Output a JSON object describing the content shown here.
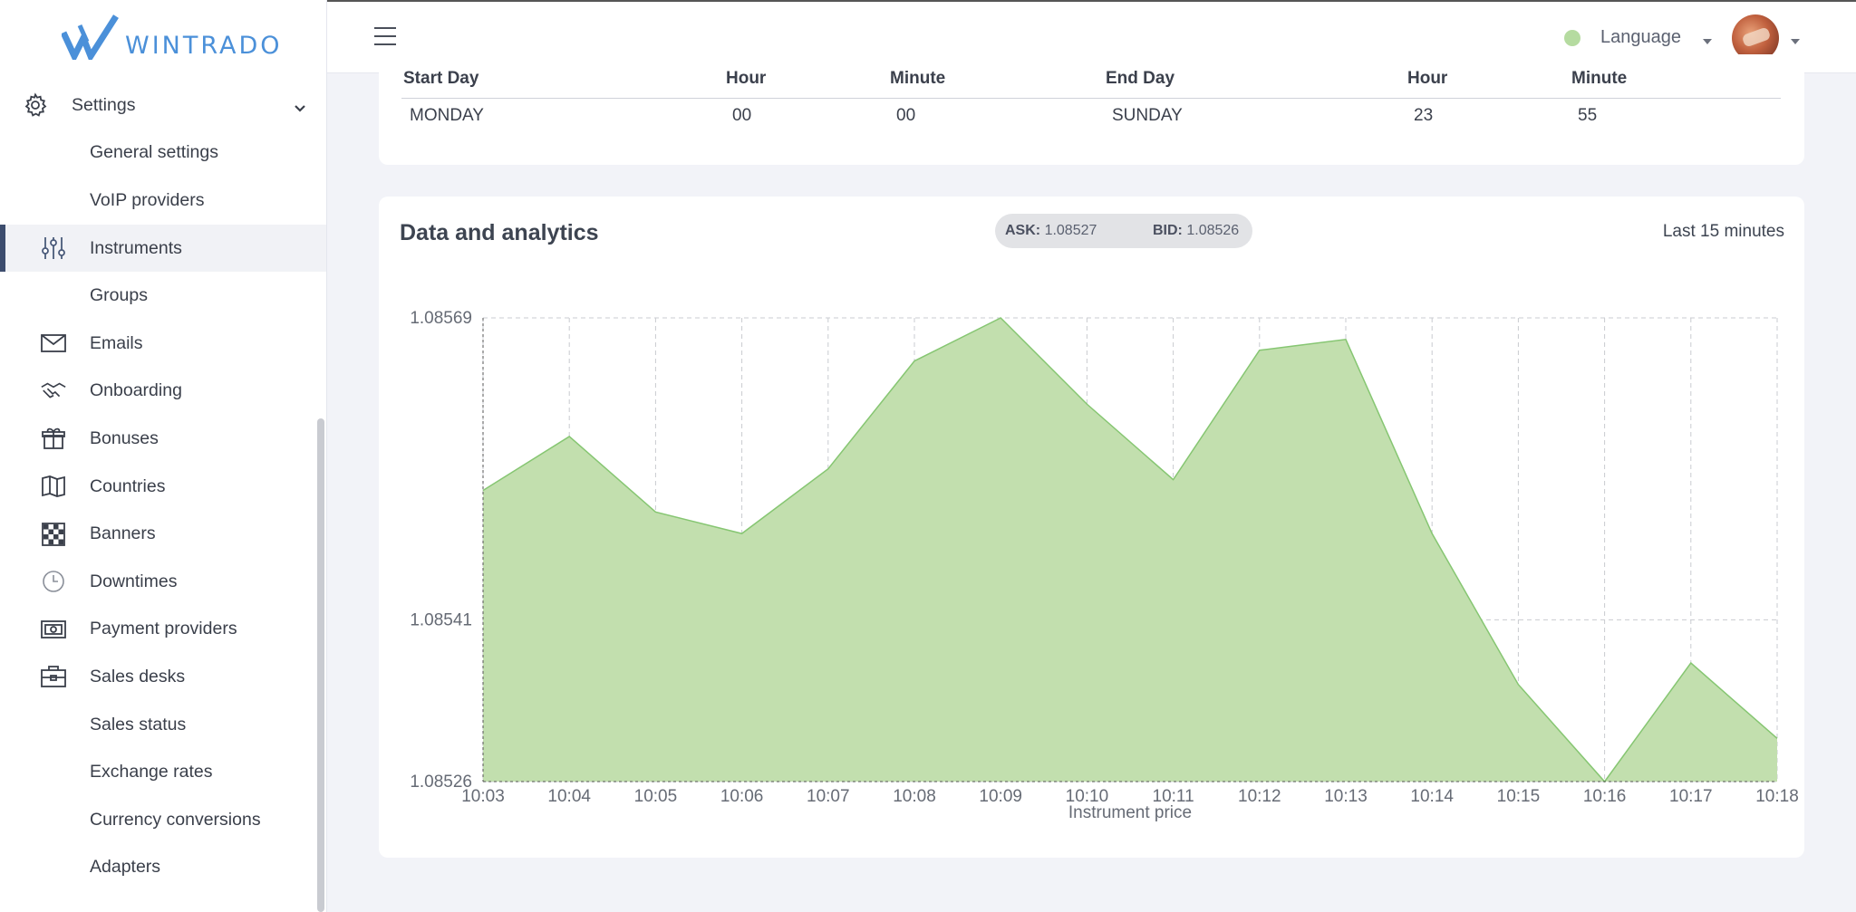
{
  "brand": {
    "name": "WINTRADO"
  },
  "sidebar": {
    "settings_label": "Settings",
    "items": [
      {
        "label": "General settings",
        "icon": "none"
      },
      {
        "label": "VoIP providers",
        "icon": "none"
      },
      {
        "label": "Instruments",
        "icon": "sliders-icon",
        "active": true
      },
      {
        "label": "Groups",
        "icon": "none"
      },
      {
        "label": "Emails",
        "icon": "envelope-icon"
      },
      {
        "label": "Onboarding",
        "icon": "handshake-icon"
      },
      {
        "label": "Bonuses",
        "icon": "gift-icon"
      },
      {
        "label": "Countries",
        "icon": "map-icon"
      },
      {
        "label": "Banners",
        "icon": "checkerboard-icon"
      },
      {
        "label": "Downtimes",
        "icon": "clock-icon"
      },
      {
        "label": "Payment providers",
        "icon": "money-icon"
      },
      {
        "label": "Sales desks",
        "icon": "briefcase-icon"
      },
      {
        "label": "Sales status",
        "icon": "none"
      },
      {
        "label": "Exchange rates",
        "icon": "none"
      },
      {
        "label": "Currency conversions",
        "icon": "none"
      },
      {
        "label": "Adapters",
        "icon": "none"
      }
    ]
  },
  "topbar": {
    "language_label": "Language",
    "status_color": "#b5dba0"
  },
  "schedule": {
    "headers": [
      "Start Day",
      "Hour",
      "Minute",
      "End Day",
      "Hour",
      "Minute"
    ],
    "row": [
      "MONDAY",
      "00",
      "00",
      "SUNDAY",
      "23",
      "55"
    ]
  },
  "analytics": {
    "title": "Data and analytics",
    "ask_label": "ASK:",
    "ask_value": "1.08527",
    "bid_label": "BID:",
    "bid_value": "1.08526",
    "range_label": "Last 15 minutes"
  },
  "chart_data": {
    "type": "area",
    "xlabel": "Instrument price",
    "categories": [
      "10:03",
      "10:04",
      "10:05",
      "10:06",
      "10:07",
      "10:08",
      "10:09",
      "10:10",
      "10:11",
      "10:12",
      "10:13",
      "10:14",
      "10:15",
      "10:16",
      "10:17",
      "10:18"
    ],
    "values": [
      1.08553,
      1.08558,
      1.08551,
      1.08549,
      1.08555,
      1.08565,
      1.08569,
      1.08561,
      1.08554,
      1.08566,
      1.08567,
      1.08549,
      1.08535,
      1.08526,
      1.08537,
      1.0853
    ],
    "yticks": [
      "1.08569",
      "1.08541",
      "1.08526"
    ],
    "ylim": [
      1.08526,
      1.08569
    ],
    "grid": true,
    "fill_color": "#c2dfae",
    "line_color": "#86c672"
  },
  "accent_color": "#4b90d9"
}
